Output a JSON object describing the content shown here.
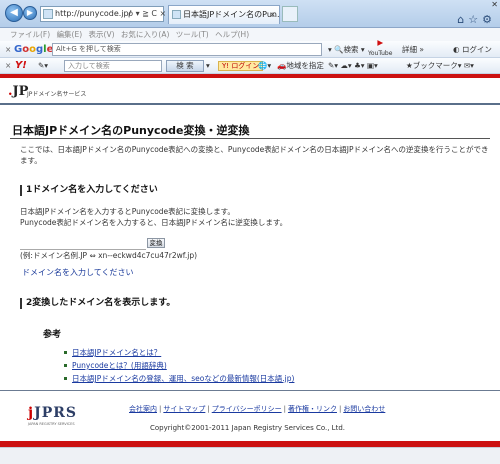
{
  "browser": {
    "address": "http://punycode.jp/",
    "address_controls": "ρ ▾ ≧ C ×",
    "tab_title": "日本語JPドメイン名のPun...",
    "tab_close": "×",
    "window_controls": "✕"
  },
  "menubar": {
    "items": [
      "ファイル(F)",
      "編集(E)",
      "表示(V)",
      "お気に入り(A)",
      "ツール(T)",
      "ヘルプ(H)"
    ]
  },
  "google_bar": {
    "close": "×",
    "logo": "Google",
    "placeholder": "Alt+G を押して検索",
    "search_btn": "検索",
    "youtube": "YouTube",
    "more": "詳細 »",
    "login": "ログイン"
  },
  "yahoo_bar": {
    "close": "×",
    "logo": "Y!",
    "placeholder": "入力して検索",
    "search_btn": "検 索",
    "login": "ログイン",
    "area": "地域を指定",
    "bookmarks": "ブックマーク"
  },
  "site": {
    "logo": "JP",
    "logo_sub": "JPドメイン名サービス",
    "page_title": "日本語JPドメイン名のPunycode変換・逆変換",
    "intro": "ここでは、日本語JPドメイン名のPunycode表記への変換と、Punycode表記ドメイン名の日本語JPドメイン名への逆変換を行うことができます。",
    "section1_title": "1ドメイン名を入力してください",
    "section1_line1": "日本語JPドメイン名を入力するとPunycode表記に変換します。",
    "section1_line2": "Punycode表記ドメイン名を入力すると、日本語JPドメイン名に逆変換します。",
    "input_value": "",
    "convert_button": "変換",
    "example": "(例:ドメイン名例.JP ⇔ xn--eckwd4c7cu47r2wf.jp)",
    "prompt_link": "ドメイン名を入力してください",
    "section2_title": "2変換したドメイン名を表示します。",
    "ref_title": "参考",
    "ref_links": [
      "日本語JPドメイン名とは？",
      "Punycodeとは？(用語辞典)",
      "日本語JPドメイン名の登録、運用、seoなどの最新情報(日本語.jp)"
    ],
    "footer_logo": "JPRS",
    "footer_logo_sub": "JAPAN REGISTRY SERVICES",
    "footer_links": [
      "会社案内",
      "サイトマップ",
      "プライバシーポリシー",
      "著作権・リンク",
      "お問い合わせ"
    ],
    "copyright": "Copyright©2001-2011 Japan Registry Services Co., Ltd."
  },
  "colors": {
    "brand_red": "#cc1111",
    "link_blue": "#1a3aa0"
  }
}
